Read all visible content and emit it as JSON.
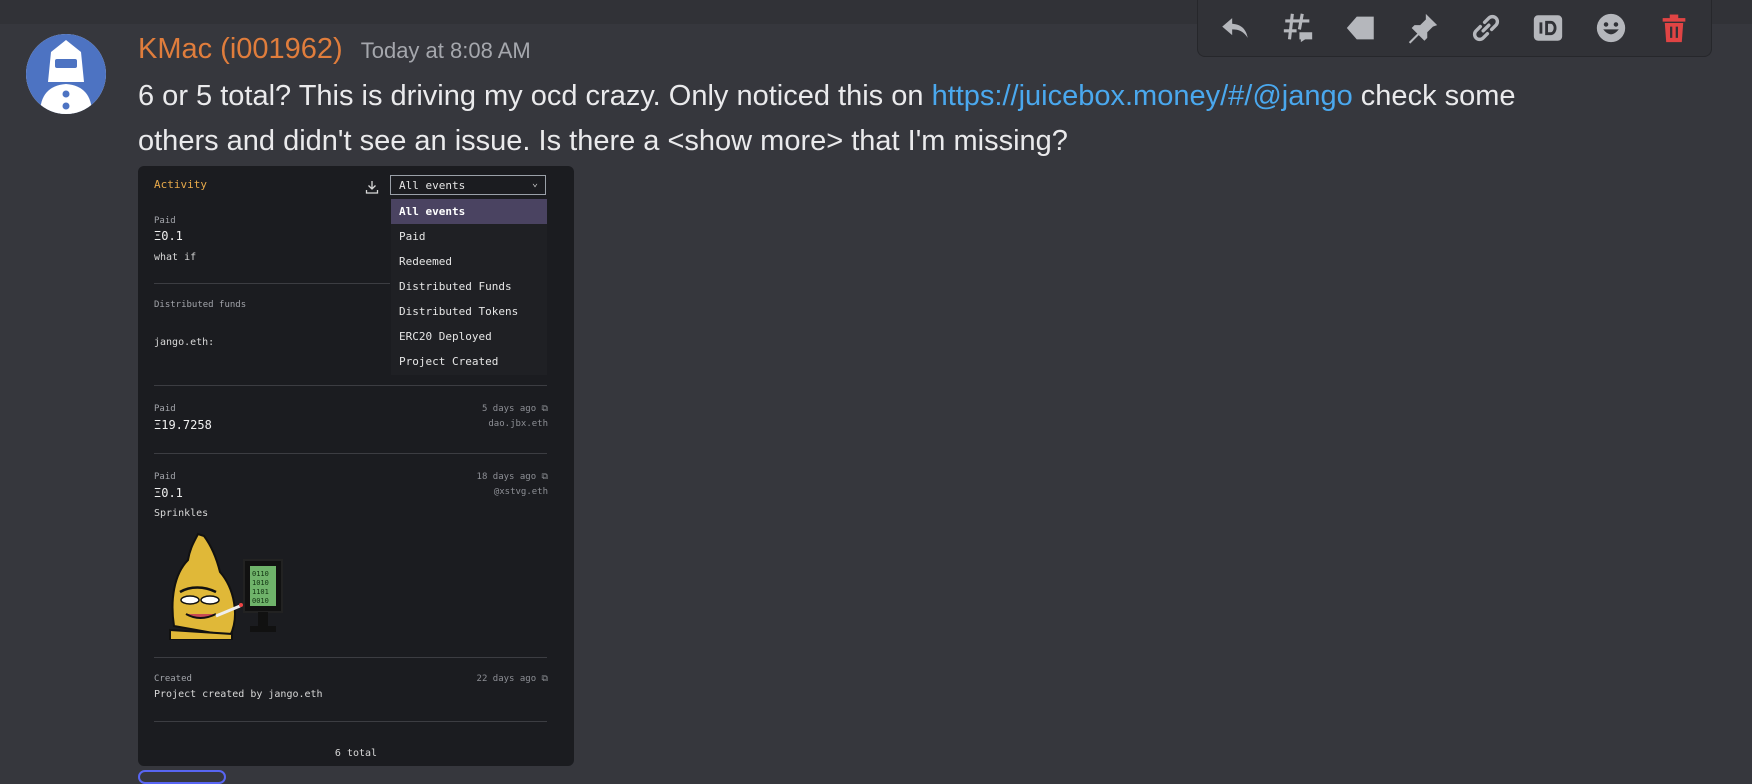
{
  "message": {
    "username": "KMac (i001962)",
    "timestamp": "Today at 8:08 AM",
    "text_before": "6 or 5 total? This is driving my ocd crazy. Only noticed this on ",
    "link": "https://juicebox.money/#/@jango",
    "text_after": " check some others and didn't see an issue. Is there a <show more> that I'm missing?"
  },
  "toolbar": {
    "icons": [
      "reply-icon",
      "create-thread-icon",
      "tag-icon",
      "pin-icon",
      "copy-link-icon",
      "copy-id-icon",
      "add-reaction-icon",
      "delete-icon"
    ]
  },
  "screenshot": {
    "activity_title": "Activity",
    "select_value": "All events",
    "dropdown_options": [
      "All events",
      "Paid",
      "Redeemed",
      "Distributed Funds",
      "Distributed Tokens",
      "ERC20 Deployed",
      "Project Created"
    ],
    "entries": [
      {
        "label": "Paid",
        "value": "Ξ0.1",
        "note": "what if"
      },
      {
        "label": "Distributed funds",
        "note": "jango.eth:"
      },
      {
        "label": "Paid",
        "value": "Ξ19.7258",
        "time": "5 days ago",
        "by": "dao.jbx.eth"
      },
      {
        "label": "Paid",
        "value": "Ξ0.1",
        "note": "Sprinkles",
        "time": "18 days ago",
        "by": "@xstvg.eth"
      },
      {
        "label": "Created",
        "note": "Project created by jango.eth",
        "time": "22 days ago"
      }
    ],
    "total": "6 total"
  },
  "colors": {
    "username": "#e07d3c",
    "link": "#4aa8ee",
    "background": "#36373d",
    "delete": "#e04444"
  }
}
